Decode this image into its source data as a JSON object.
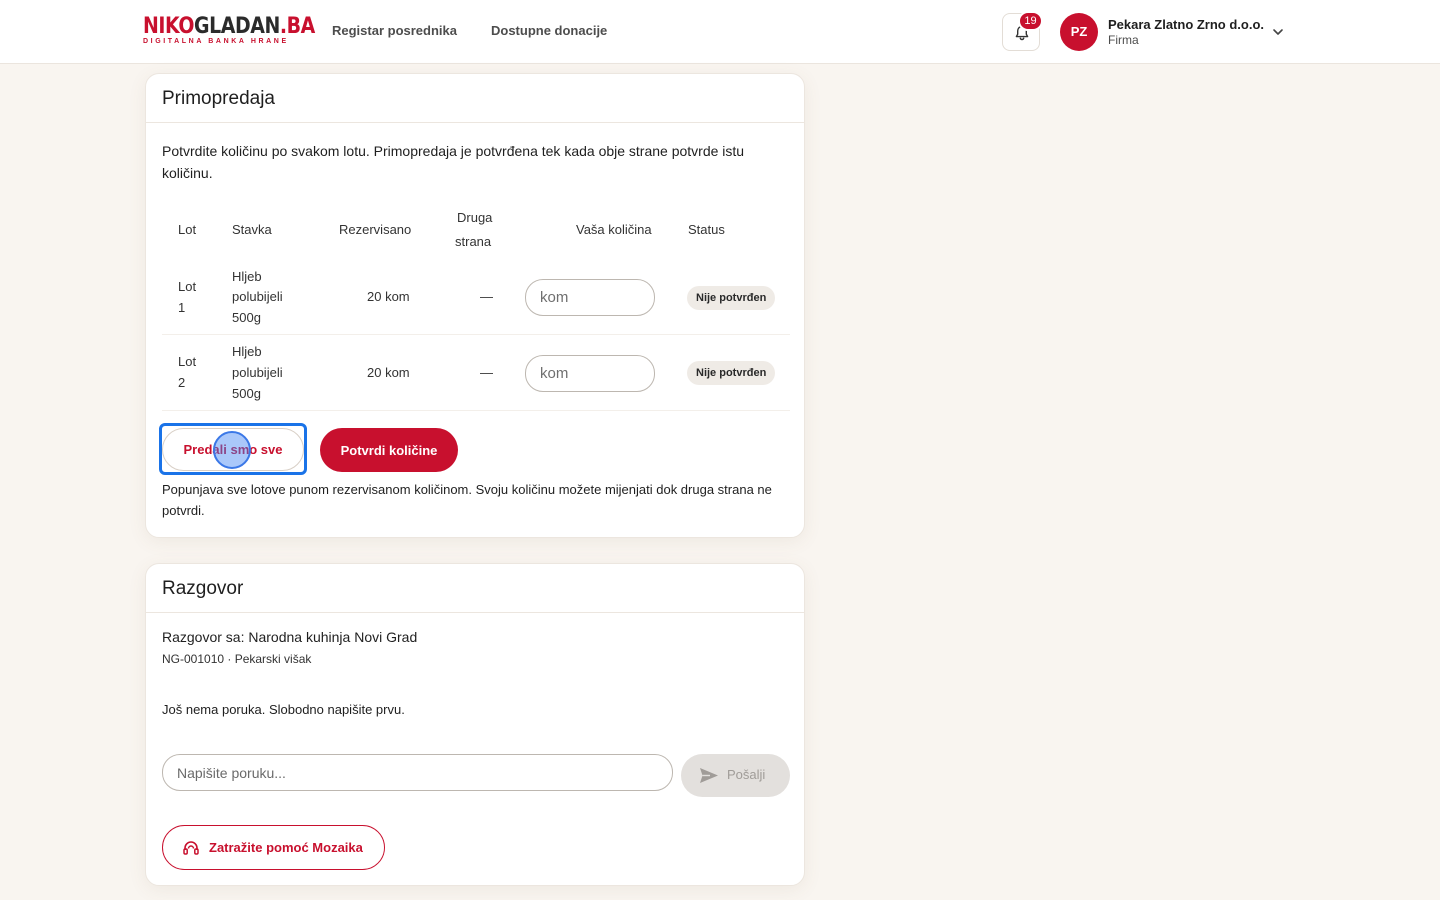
{
  "header": {
    "logo_main_red": "NIKO",
    "logo_main_dark": "GLADAN",
    "logo_main_red2": ".BA",
    "logo_sub": "DIGITALNA BANKA HRANE",
    "nav": [
      "Registar posrednika",
      "Dostupne donacije"
    ],
    "notifications_count": "19",
    "user_initials": "PZ",
    "user_name": "Pekara Zlatno Zrno d.o.o.",
    "user_role": "Firma"
  },
  "handover": {
    "title": "Primopredaja",
    "intro": "Potvrdite količinu po svakom lotu. Primopredaja je potvrđena tek kada obje strane potvrde istu količinu.",
    "columns": {
      "lot": "Lot",
      "item": "Stavka",
      "reserved": "Rezervisano",
      "other_line1": "Druga",
      "other_line2": "strana",
      "your_qty": "Vaša količina",
      "status": "Status"
    },
    "rows": [
      {
        "lot_line1": "Lot",
        "lot_line2": "1",
        "item_line1": "Hljeb",
        "item_line2": "polubijeli",
        "item_line3": "500g",
        "reserved": "20 kom",
        "other": "—",
        "qty_placeholder": "kom",
        "status": "Nije potvrđen"
      },
      {
        "lot_line1": "Lot",
        "lot_line2": "2",
        "item_line1": "Hljeb",
        "item_line2": "polubijeli",
        "item_line3": "500g",
        "reserved": "20 kom",
        "other": "—",
        "qty_placeholder": "kom",
        "status": "Nije potvrđen"
      }
    ],
    "btn_handed_all": "Predali smo sve",
    "btn_confirm": "Potvrdi količine",
    "note": "Popunjava sve lotove punom rezervisanom količinom. Svoju količinu možete mijenjati dok druga strana ne potvrdi."
  },
  "chat": {
    "title": "Razgovor",
    "with": "Razgovor sa: Narodna kuhinja Novi Grad",
    "meta": "NG-001010 · Pekarski višak",
    "empty": "Još nema poruka. Slobodno napišite prvu.",
    "input_placeholder": "Napišite poruku...",
    "send_label": "Pošalji",
    "help_label": "Zatražite pomoć Mozaika"
  },
  "colors": {
    "brand": "#c8102e",
    "background": "#f9f5f0",
    "focus": "#1a73e8"
  }
}
